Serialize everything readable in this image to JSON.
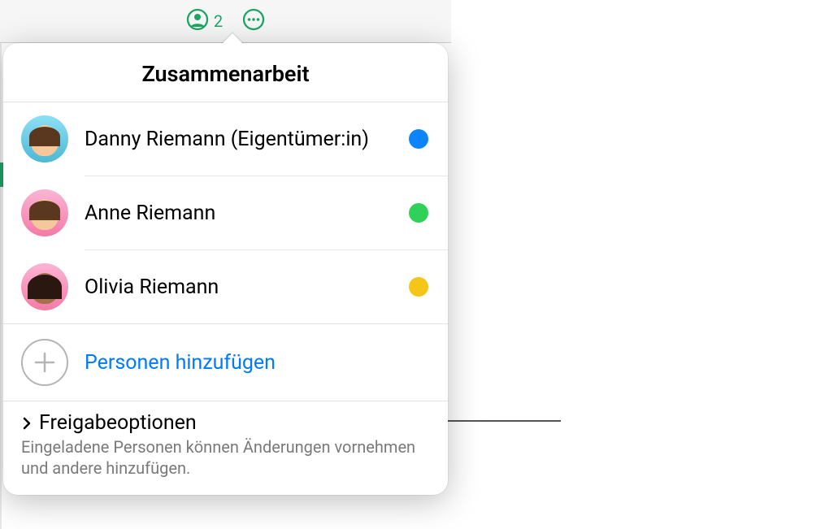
{
  "toolbar": {
    "participant_count": "2"
  },
  "popover": {
    "title": "Zusammenarbeit",
    "people": [
      {
        "name": "Danny Riemann (Eigentümer:in)",
        "status_color": "#0a84ff"
      },
      {
        "name": "Anne Riemann",
        "status_color": "#30d158"
      },
      {
        "name": "Olivia Riemann",
        "status_color": "#f5c518"
      }
    ],
    "add_people_label": "Personen hinzufügen",
    "sharing": {
      "title": "Freigabeoptionen",
      "subtitle": "Eingeladene Personen können Änderungen vornehmen und andere hinzufügen."
    }
  }
}
